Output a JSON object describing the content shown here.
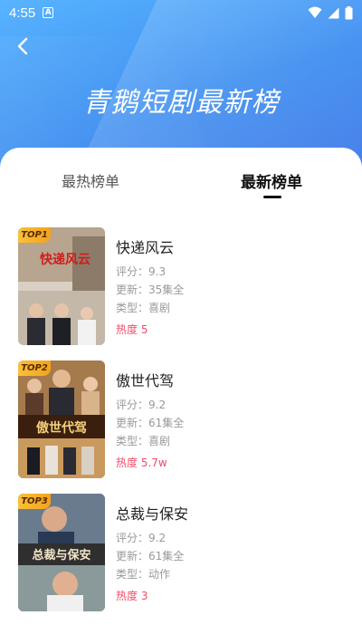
{
  "status_bar": {
    "time": "4:55",
    "icon_a": "A"
  },
  "header": {
    "title": "青鹅短剧最新榜"
  },
  "tabs": [
    {
      "label": "最热榜单",
      "active": false
    },
    {
      "label": "最新榜单",
      "active": true
    }
  ],
  "items": [
    {
      "rank": "TOP1",
      "name": "快递风云",
      "score": "评分：9.3",
      "update": "更新：35集全",
      "genre": "类型：喜剧",
      "heat": "热度 5",
      "poster_title": "快递风云"
    },
    {
      "rank": "TOP2",
      "name": "傲世代驾",
      "score": "评分：9.2",
      "update": "更新：61集全",
      "genre": "类型：喜剧",
      "heat": "热度 5.7w",
      "poster_title": "傲世代驾"
    },
    {
      "rank": "TOP3",
      "name": "总裁与保安",
      "score": "评分：9.2",
      "update": "更新：61集全",
      "genre": "类型：动作",
      "heat": "热度 3",
      "poster_title": "总裁与保安"
    }
  ],
  "colors": {
    "header_start": "#58b4ff",
    "header_end": "#4a7fe8",
    "heat": "#f24b6a",
    "badge": "#f8c13a"
  },
  "icons": {
    "back": "chevron-left-icon",
    "wifi": "wifi-icon",
    "signal": "signal-icon",
    "battery": "battery-icon"
  }
}
